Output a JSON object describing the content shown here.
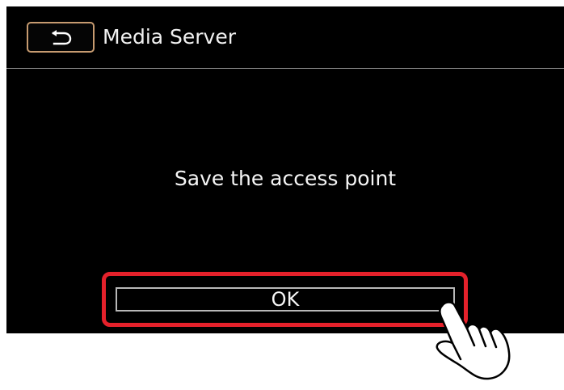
{
  "screen": {
    "title": "Media Server",
    "message": "Save the access point"
  },
  "buttons": {
    "back_icon": "back-arrow-icon",
    "ok_label": "OK"
  },
  "annotations": {
    "highlight_color": "#e5212b",
    "pointer_icon": "hand-pointer-icon"
  },
  "colors": {
    "screen_background": "#000000",
    "text": "#f5f5f5",
    "back_button_border": "#c79b70",
    "ok_button_border": "#b8b8b8"
  }
}
